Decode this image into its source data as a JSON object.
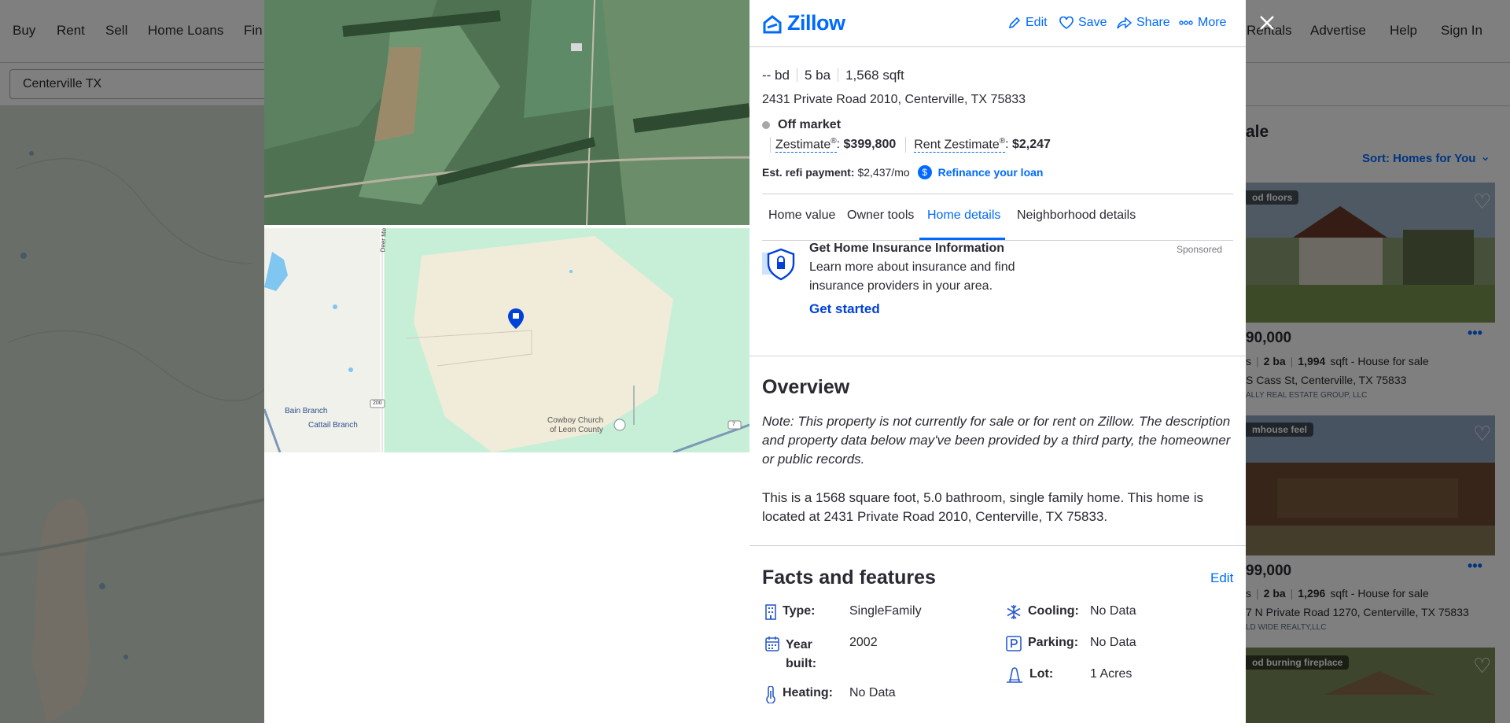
{
  "topnav": {
    "left": [
      "Buy",
      "Rent",
      "Sell",
      "Home Loans",
      "Fin"
    ],
    "right": [
      "Rentals",
      "Advertise",
      "Help",
      "Sign In"
    ]
  },
  "search": {
    "value": "Centerville TX"
  },
  "listings": {
    "heading": "ale",
    "sort": "Sort: Homes for You",
    "cards": [
      {
        "badge": "od floors",
        "price": "90,000",
        "beds": "s",
        "baths": "2 ba",
        "sqft": "1,994",
        "sqft_suffix": "sqft - House for sale",
        "address": "S Cass St, Centerville, TX 75833",
        "broker": "ALLY REAL ESTATE GROUP, LLC"
      },
      {
        "badge": "mhouse feel",
        "price": "99,000",
        "beds": "s",
        "baths": "2 ba",
        "sqft": "1,296",
        "sqft_suffix": "sqft - House for sale",
        "address": "7 N Private Road 1270, Centerville, TX 75833",
        "broker": "LD WIDE REALTY,LLC"
      },
      {
        "badge": "od burning fireplace"
      }
    ]
  },
  "map_labels": {
    "deer_meadows": "Deer Meadows Rd",
    "bain": "Bain Branch",
    "cattail": "Cattail Branch",
    "cowboy_1": "Cowboy Church",
    "cowboy_2": "of Leon County",
    "road_200": "200",
    "road_7": "7"
  },
  "header": {
    "logo": "Zillow",
    "edit": "Edit",
    "save": "Save",
    "share": "Share",
    "more": "More"
  },
  "summary": {
    "beds": "-- bd",
    "baths": "5 ba",
    "sqft": "1,568 sqft",
    "address": "2431 Private Road 2010, Centerville, TX 75833",
    "status": "Off market",
    "zestimate_label": "Zestimate",
    "zestimate_value": "$399,800",
    "rent_label": "Rent Zestimate",
    "rent_value": "$2,247",
    "refi_label": "Est. refi payment:",
    "refi_value": "$2,437/mo",
    "refi_link": "Refinance your loan"
  },
  "tabs": [
    "Home value",
    "Owner tools",
    "Home details",
    "Neighborhood details"
  ],
  "active_tab": "Home details",
  "ad": {
    "title": "Get Home Insurance Information",
    "body1": "Learn more about insurance and find",
    "body2": "insurance providers in your area.",
    "cta": "Get started",
    "sponsored": "Sponsored"
  },
  "overview": {
    "title": "Overview",
    "note": "Note: This property is not currently for sale or for rent on Zillow. The description and property data below may've been provided by a third party, the homeowner or public records.",
    "description": "This is a 1568 square foot, 5.0 bathroom, single family home. This home is located at 2431 Private Road 2010, Centerville, TX 75833."
  },
  "facts": {
    "title": "Facts and features",
    "edit": "Edit",
    "type_label": "Type:",
    "type_value": "SingleFamily",
    "year_label_1": "Year",
    "year_label_2": "built:",
    "year_value": "2002",
    "heating_label": "Heating:",
    "heating_value": "No Data",
    "cooling_label": "Cooling:",
    "cooling_value": "No Data",
    "parking_label": "Parking:",
    "parking_value": "No Data",
    "lot_label": "Lot:",
    "lot_value": "1 Acres"
  },
  "colors": {
    "accent": "#006aff",
    "text": "#2a2a33"
  }
}
